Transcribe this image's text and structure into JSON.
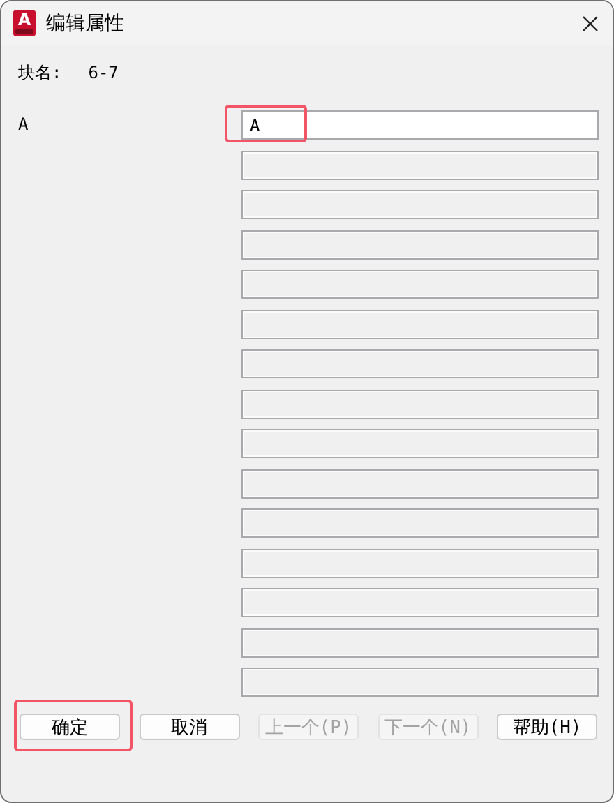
{
  "window": {
    "title": "编辑属性",
    "app_icon_letter": "A"
  },
  "block_name": {
    "label": "块名:",
    "value": "6-7"
  },
  "attributes": [
    {
      "label": "A",
      "value": "A",
      "disabled": false,
      "highlighted": true
    },
    {
      "disabled": true
    },
    {
      "disabled": true
    },
    {
      "disabled": true
    },
    {
      "disabled": true
    },
    {
      "disabled": true
    },
    {
      "disabled": true
    },
    {
      "disabled": true
    },
    {
      "disabled": true
    },
    {
      "disabled": true
    },
    {
      "disabled": true
    },
    {
      "disabled": true
    },
    {
      "disabled": true
    },
    {
      "disabled": true
    },
    {
      "disabled": true
    }
  ],
  "buttons": [
    {
      "label": "确定",
      "disabled": false,
      "highlighted": true
    },
    {
      "label": "取消",
      "disabled": false,
      "highlighted": false
    },
    {
      "label": "上一个(P)",
      "disabled": true,
      "highlighted": false
    },
    {
      "label": "下一个(N)",
      "disabled": true,
      "highlighted": false
    },
    {
      "label": "帮助(H)",
      "disabled": false,
      "highlighted": false
    }
  ]
}
